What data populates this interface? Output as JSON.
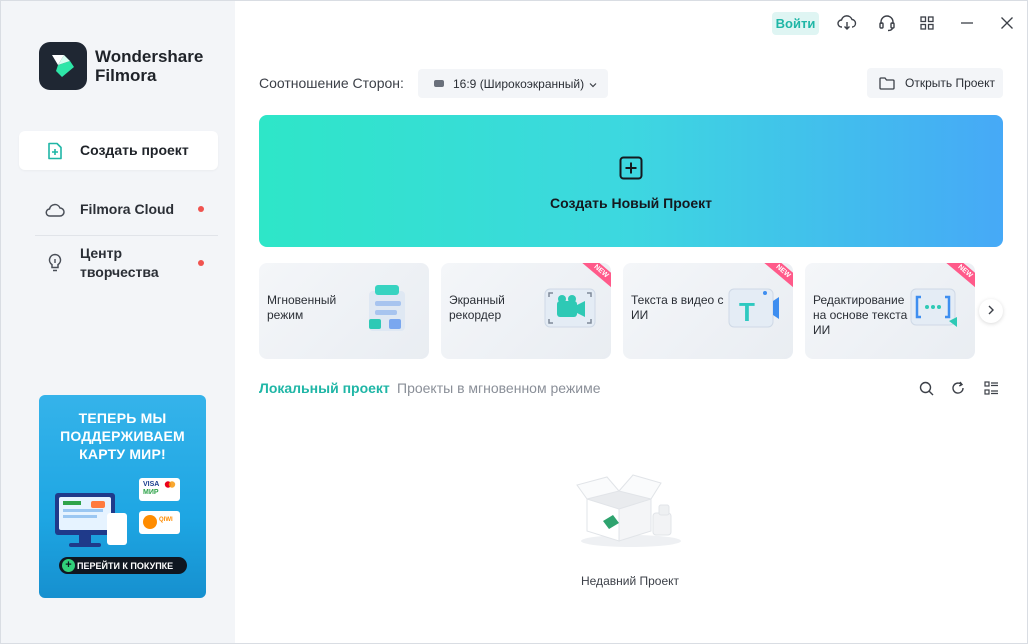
{
  "app": {
    "name_line1": "Wondershare",
    "name_line2": "Filmora"
  },
  "sidebar": {
    "items": [
      {
        "label": "Создать проект",
        "icon": "new-project-icon",
        "active": true
      },
      {
        "label": "Filmora Cloud",
        "icon": "cloud-icon",
        "dot": true
      },
      {
        "label": "Центр\nтворчества",
        "icon": "lightbulb-icon",
        "dot": true
      }
    ],
    "banner": {
      "line1": "ТЕПЕРЬ МЫ",
      "line2": "ПОДДЕРЖИВАЕМ",
      "line3": "КАРТУ МИР!",
      "cta": "ПЕРЕЙТИ К ПОКУПКЕ",
      "card1": "VISA",
      "card1_sub": "МИР",
      "card2": "QIWI"
    }
  },
  "topbar": {
    "login": "Войти",
    "icons": [
      "cloud-download-icon",
      "headset-icon",
      "grid-icon",
      "minimize-icon",
      "close-icon"
    ]
  },
  "aspect": {
    "label": "Соотношение Сторон:",
    "value": "16:9 (Широкоэкранный)"
  },
  "open_project": "Открыть Проект",
  "hero": {
    "label": "Создать Новый Проект"
  },
  "features": [
    {
      "title": "Мгновенный режим",
      "new": false
    },
    {
      "title": "Экранный рекордер",
      "new": true
    },
    {
      "title": "Текста в видео с ИИ",
      "new": true
    },
    {
      "title": "Редактирование на основе текста ИИ",
      "new": true
    }
  ],
  "new_badge": "NEW",
  "tabs": {
    "local": "Локальный проект",
    "instant": "Проекты в мгновенном режиме"
  },
  "empty": {
    "label": "Недавний Проект"
  },
  "colors": {
    "accent": "#1fb6a6",
    "hero_start": "#2ee6c8",
    "hero_end": "#46a9f7",
    "dot": "#f0534f"
  }
}
